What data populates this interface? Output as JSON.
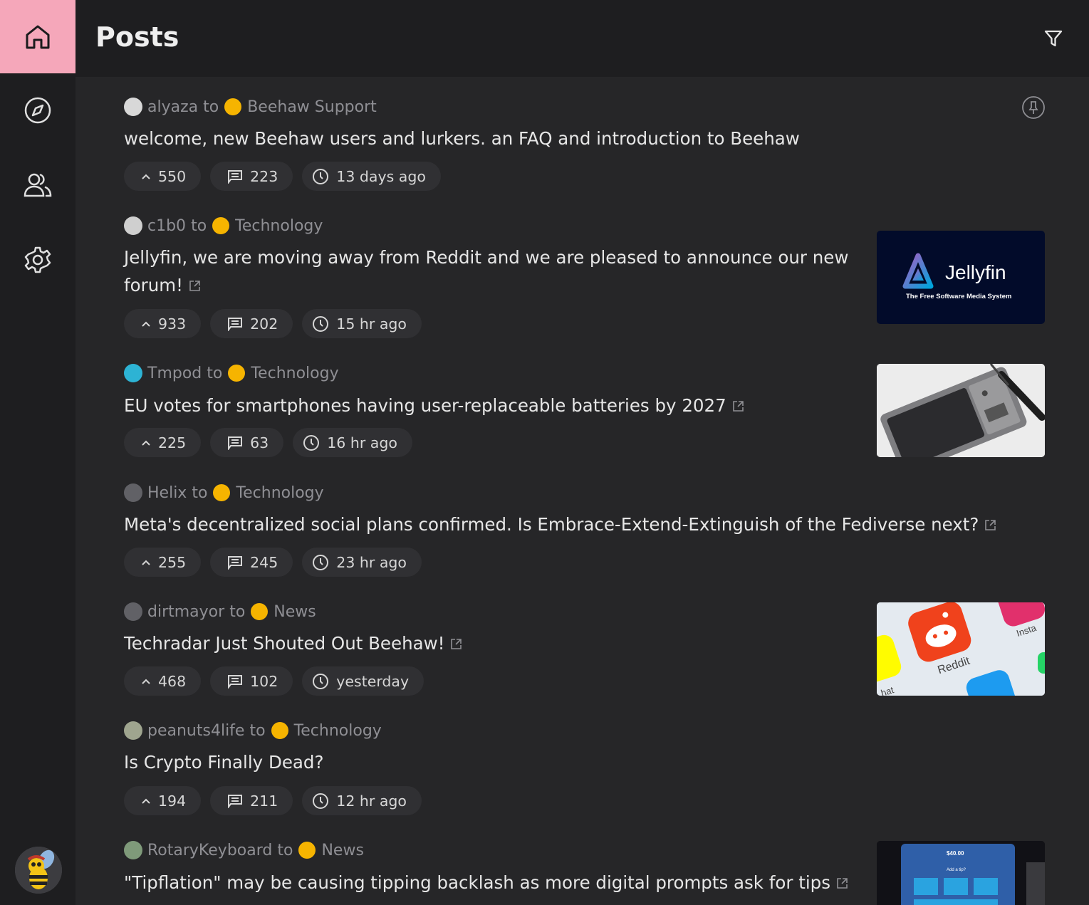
{
  "app": {
    "page_title": "Posts"
  },
  "sidebar": {
    "items": [
      "home",
      "explore",
      "communities",
      "settings"
    ]
  },
  "colors": {
    "accent": "#f5a7ba",
    "background": "#262628",
    "sidebar": "#1e1e20",
    "pill": "#303033",
    "community_icon": "#f6b400"
  },
  "icons": [
    "home-icon",
    "compass-icon",
    "users-icon",
    "gear-icon",
    "filter-icon",
    "pin-icon",
    "upvote-icon",
    "comment-icon",
    "clock-icon",
    "external-link-icon"
  ],
  "posts": [
    {
      "author": "alyaza",
      "to": "to",
      "community": "Beehaw Support",
      "title": "welcome, new Beehaw users and lurkers. an FAQ and introduction to Beehaw",
      "external": false,
      "upvotes": "550",
      "comments": "223",
      "time": "13 days ago",
      "pinned": true
    },
    {
      "author": "c1b0",
      "to": "to",
      "community": "Technology",
      "title": "Jellyfin, we are moving away from Reddit and we are pleased to announce our new forum!",
      "external": true,
      "upvotes": "933",
      "comments": "202",
      "time": "15 hr ago",
      "thumbnail": {
        "logo_text": "Jellyfin",
        "tagline": "The Free Software Media System"
      }
    },
    {
      "author": "Tmpod",
      "to": "to",
      "community": "Technology",
      "title": "EU votes for smartphones having user-replaceable batteries by 2027",
      "external": true,
      "upvotes": "225",
      "comments": "63",
      "time": "16 hr ago",
      "thumbnail": {}
    },
    {
      "author": "Helix",
      "to": "to",
      "community": "Technology",
      "title": "Meta's decentralized social plans confirmed. Is Embrace-Extend-Extinguish of the Fediverse next?",
      "external": true,
      "upvotes": "255",
      "comments": "245",
      "time": "23 hr ago"
    },
    {
      "author": "dirtmayor",
      "to": "to",
      "community": "News",
      "title": "Techradar Just Shouted Out Beehaw!",
      "external": true,
      "upvotes": "468",
      "comments": "102",
      "time": "yesterday",
      "thumbnail": {
        "label_reddit": "Reddit",
        "label_insta": "Insta",
        "label_chat": "hat"
      }
    },
    {
      "author": "peanuts4life",
      "to": "to",
      "community": "Technology",
      "title": "Is Crypto Finally Dead?",
      "external": false,
      "upvotes": "194",
      "comments": "211",
      "time": "12 hr ago"
    },
    {
      "author": "RotaryKeyboard",
      "to": "to",
      "community": "News",
      "title": "\"Tipflation\" may be causing tipping backlash as more digital prompts ask for tips",
      "external": true,
      "thumbnail": {
        "amount": "$40.00",
        "prompt": "Add a tip?"
      }
    }
  ]
}
